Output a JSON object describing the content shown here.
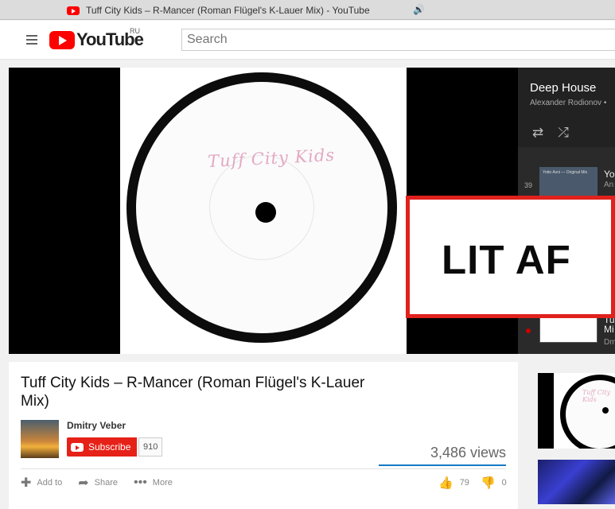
{
  "browser_tab": {
    "title": "Tuff City Kids – R-Mancer (Roman Flügel's K-Lauer Mix) - YouTube",
    "audio_icon": "speaker-icon"
  },
  "header": {
    "logo_text": "YouTube",
    "region": "RU",
    "search_placeholder": "Search"
  },
  "player": {
    "artwork_text": "Tuff City Kids"
  },
  "overlay": {
    "text": "LIT AF"
  },
  "playlist": {
    "title": "Deep House",
    "owner": "Alexander Rodionov •",
    "items": [
      {
        "index": "39",
        "thumb_text": "Yotto Avni — Original Mix",
        "title": "Yo",
        "subtitle": "An"
      },
      {
        "index": "",
        "title": "Tu",
        "title2": "Mi",
        "subtitle": "Dm"
      }
    ]
  },
  "video": {
    "title": "Tuff City Kids – R-Mancer (Roman Flügel's K-Lauer Mix)",
    "channel": "Dmitry Veber",
    "subscribe_label": "Subscribe",
    "subscriber_count": "910",
    "views": "3,486 views",
    "like_ratio": 1.0,
    "actions": {
      "add_to": "Add to",
      "share": "Share",
      "more": "More"
    },
    "likes": "79",
    "dislikes": "0"
  },
  "sidebar": {
    "next_thumb_text": "Tuff City Kids"
  },
  "colors": {
    "brand_red": "#ff0000",
    "subscribe_red": "#e62117",
    "overlay_border": "#e0211d",
    "like_bar": "#167ac6"
  }
}
